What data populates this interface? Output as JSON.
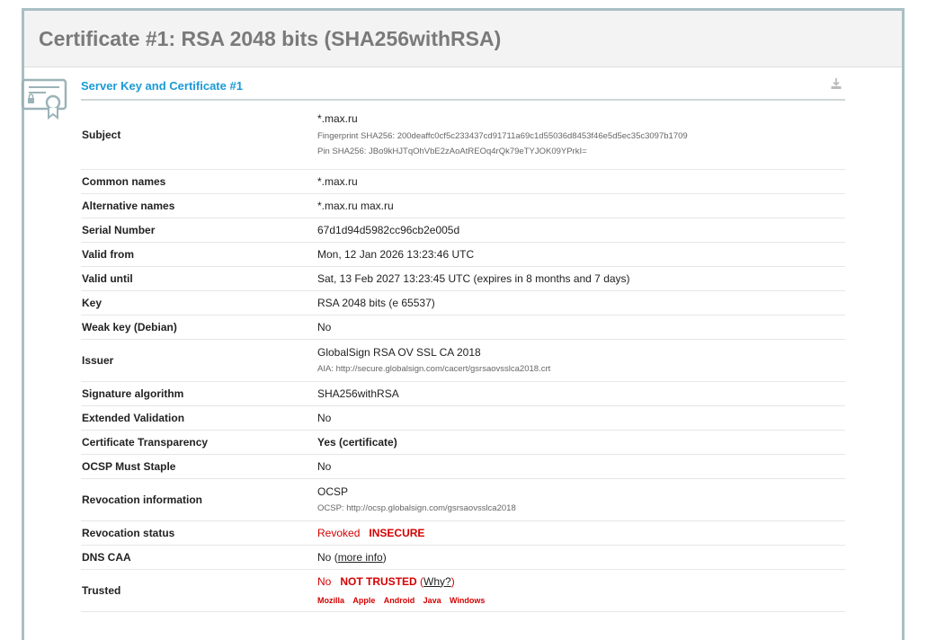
{
  "header": {
    "title": "Certificate #1: RSA 2048 bits (SHA256withRSA)"
  },
  "section": {
    "title": "Server Key and Certificate #1",
    "download_icon": "download-icon",
    "cert_icon": "certificate-icon"
  },
  "rows": {
    "subject": {
      "label": "Subject",
      "value": "*.max.ru",
      "fingerprint": "Fingerprint SHA256: 200deaffc0cf5c233437cd91711a69c1d55036d8453f46e5d5ec35c3097b1709",
      "pin": "Pin SHA256: JBo9kHJTqOhVbE2zAoAtREOq4rQk79eTYJOK09YPrkI="
    },
    "common_names": {
      "label": "Common names",
      "value": "*.max.ru"
    },
    "alt_names": {
      "label": "Alternative names",
      "value": "*.max.ru max.ru"
    },
    "serial": {
      "label": "Serial Number",
      "value": "67d1d94d5982cc96cb2e005d"
    },
    "valid_from": {
      "label": "Valid from",
      "value": "Mon, 12 Jan 2026 13:23:46 UTC"
    },
    "valid_until": {
      "label": "Valid until",
      "value": "Sat, 13 Feb 2027 13:23:45 UTC (expires in 8 months and 7 days)"
    },
    "key": {
      "label": "Key",
      "value": "RSA 2048 bits (e 65537)"
    },
    "weak_key": {
      "label": "Weak key (Debian)",
      "value": "No"
    },
    "issuer": {
      "label": "Issuer",
      "value": "GlobalSign RSA OV SSL CA 2018",
      "aia": "AIA: http://secure.globalsign.com/cacert/gsrsaovsslca2018.crt"
    },
    "sig_alg": {
      "label": "Signature algorithm",
      "value": "SHA256withRSA"
    },
    "ev": {
      "label": "Extended Validation",
      "value": "No"
    },
    "ct": {
      "label": "Certificate Transparency",
      "value": "Yes (certificate)"
    },
    "ocsp_staple": {
      "label": "OCSP Must Staple",
      "value": "No"
    },
    "revocation_info": {
      "label": "Revocation information",
      "value": "OCSP",
      "ocsp": "OCSP: http://ocsp.globalsign.com/gsrsaovsslca2018"
    },
    "revocation_status": {
      "label": "Revocation status",
      "value": "Revoked",
      "flag": "INSECURE"
    },
    "dns_caa": {
      "label": "DNS CAA",
      "value": "No",
      "link_open": "(",
      "link": "more info",
      "link_close": ")"
    },
    "trusted": {
      "label": "Trusted",
      "value": "No",
      "flag": "NOT TRUSTED",
      "why_open": "(",
      "why": "Why?",
      "why_close": ")",
      "stores": [
        "Mozilla",
        "Apple",
        "Android",
        "Java",
        "Windows"
      ]
    }
  },
  "colors": {
    "accent": "#1b9ad6",
    "good": "#0b8a0b",
    "bad": "#d40000",
    "warn": "#e08a1e",
    "frame": "#a9bfc4"
  }
}
